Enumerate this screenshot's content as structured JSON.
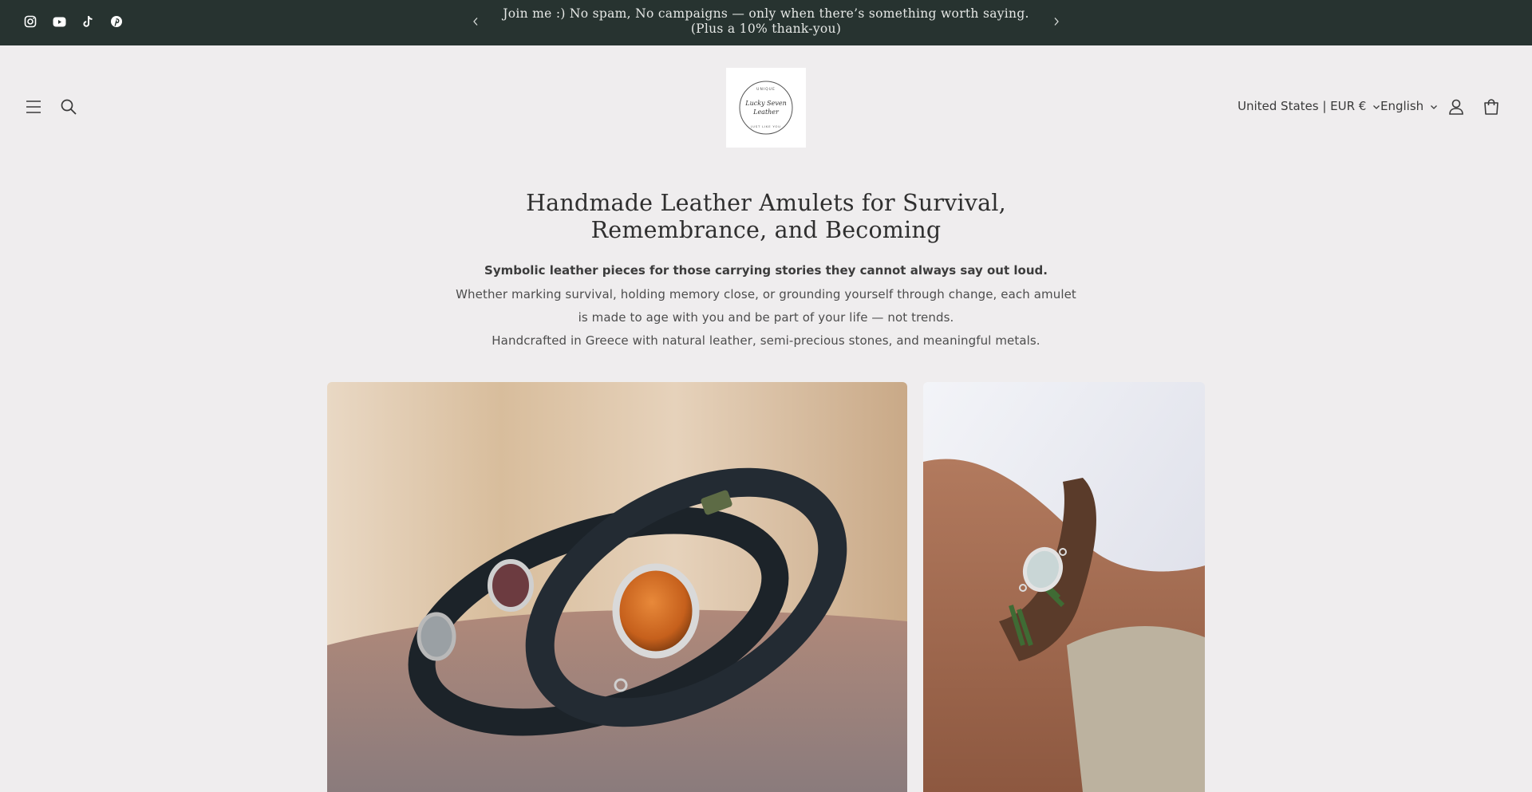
{
  "announcement": {
    "message": "Join me :) No spam, No campaigns — only when there’s something worth saying. (Plus a 10% thank-you)",
    "social": [
      {
        "name": "instagram-icon"
      },
      {
        "name": "youtube-icon"
      },
      {
        "name": "tiktok-icon"
      },
      {
        "name": "pinterest-icon"
      }
    ]
  },
  "header": {
    "logo_text": {
      "top": "UNIQUE",
      "script": "Lucky Seven Leather",
      "bottom": "JUST LIKE YOU"
    },
    "country": "United States | EUR €",
    "language": "English"
  },
  "hero": {
    "title": "Handmade Leather Amulets for Survival, Remembrance, and Becoming",
    "lead": "Symbolic leather pieces for those carrying stories they cannot always say out loud.",
    "body_line1": "Whether marking survival, holding memory close, or grounding yourself through change, each amulet is made to age with you and be part of your life — not trends.",
    "body_line2": "Handcrafted in Greece with natural leather, semi-precious stones, and meaningful metals."
  },
  "colors": {
    "announcement_bg": "#273330",
    "page_bg": "#efedee"
  }
}
